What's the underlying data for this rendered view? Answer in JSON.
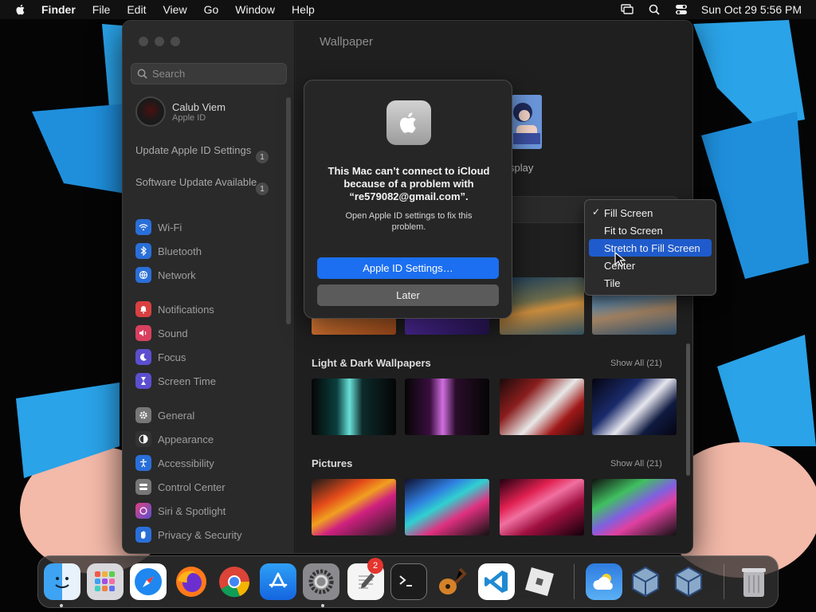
{
  "menubar": {
    "app_name": "Finder",
    "items": [
      "File",
      "Edit",
      "View",
      "Go",
      "Window",
      "Help"
    ],
    "clock": "Sun Oct 29  5:56 PM"
  },
  "sidebar": {
    "search_placeholder": "Search",
    "user": {
      "name": "Calub Viem",
      "subtitle": "Apple ID"
    },
    "notices": [
      {
        "label": "Update Apple ID Settings",
        "count": "1"
      },
      {
        "label": "Software Update Available",
        "count": "1"
      }
    ],
    "items": [
      {
        "label": "Wi-Fi",
        "icon": "wifi-icon",
        "color": "#2a6fd9"
      },
      {
        "label": "Bluetooth",
        "icon": "bluetooth-icon",
        "color": "#2a6fd9"
      },
      {
        "label": "Network",
        "icon": "network-icon",
        "color": "#2a6fd9"
      },
      {
        "label": "Notifications",
        "icon": "bell-icon",
        "color": "#d94040"
      },
      {
        "label": "Sound",
        "icon": "speaker-icon",
        "color": "#d94060"
      },
      {
        "label": "Focus",
        "icon": "moon-icon",
        "color": "#5b4fd0"
      },
      {
        "label": "Screen Time",
        "icon": "hourglass-icon",
        "color": "#5b4fd0"
      },
      {
        "label": "General",
        "icon": "gear-icon",
        "color": "#777777"
      },
      {
        "label": "Appearance",
        "icon": "appearance-icon",
        "color": "#333333"
      },
      {
        "label": "Accessibility",
        "icon": "accessibility-icon",
        "color": "#2a6fd9"
      },
      {
        "label": "Control Center",
        "icon": "control-center-icon",
        "color": "#777777"
      },
      {
        "label": "Siri & Spotlight",
        "icon": "siri-icon",
        "color": "#a040c0"
      },
      {
        "label": "Privacy & Security",
        "icon": "hand-icon",
        "color": "#2a6fd9"
      }
    ]
  },
  "content": {
    "title": "Wallpaper",
    "display_label": "splay",
    "sections": [
      {
        "title": "Light & Dark Wallpapers",
        "show_all": "Show All (21)"
      },
      {
        "title": "Pictures",
        "show_all": "Show All (21)"
      }
    ]
  },
  "alert": {
    "message": "This Mac can’t connect to iCloud because of a problem with “re579082@gmail.com”.",
    "info": "Open Apple ID settings to fix this problem.",
    "primary_button": "Apple ID Settings…",
    "secondary_button": "Later"
  },
  "dropdown": {
    "options": [
      "Fill Screen",
      "Fit to Screen",
      "Stretch to Fill Screen",
      "Center",
      "Tile"
    ],
    "checkmark": "✓",
    "selected": "Fill Screen",
    "highlighted": "Stretch to Fill Screen"
  },
  "dock": {
    "badge_count": "2",
    "apps": [
      "Finder",
      "Launchpad",
      "Safari",
      "Firefox",
      "Chrome",
      "App Store",
      "System Settings",
      "TextEdit",
      "Terminal",
      "GarageBand",
      "Visual Studio Code",
      "Roblox",
      "Weather",
      "VirtualBox",
      "VirtualBox VM",
      "Trash"
    ]
  }
}
